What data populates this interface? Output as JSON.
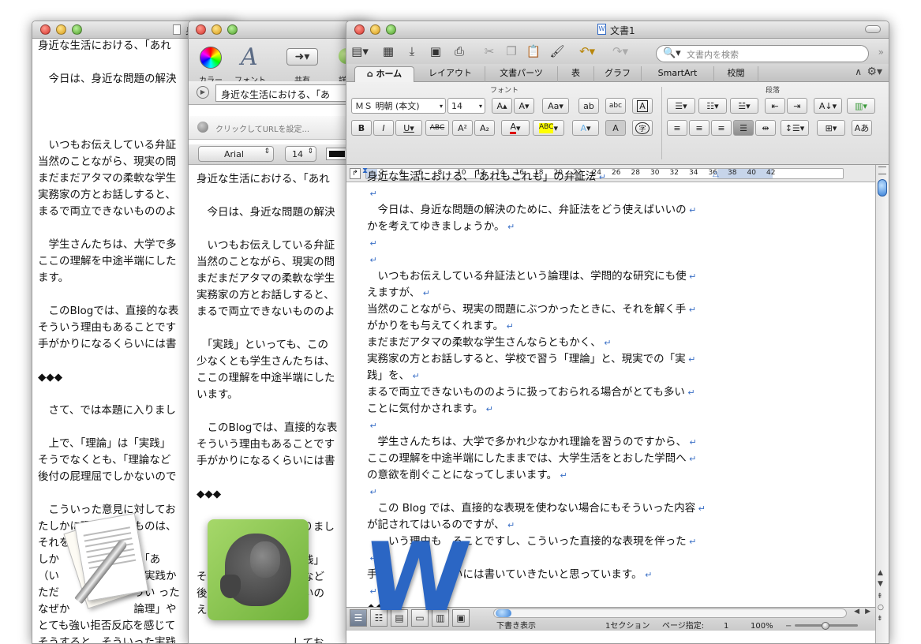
{
  "win1": {
    "title_fragment": "身",
    "lines": [
      "身近な生活における、「あれ",
      "",
      "　今日は、身近な問題の解決",
      "",
      "",
      "",
      "　いつもお伝えしている弁証",
      "当然のことながら、現実の問",
      "まだまだアタマの柔軟な学生",
      "実務家の方とお話しすると、",
      "まるで両立できないもののよ",
      "",
      "　学生さんたちは、大学で多",
      "ここの理解を中途半端にした",
      "ます。",
      "",
      "　このBlogでは、直接的な表",
      "そういう理由もあることです",
      "手がかりになるくらいには書",
      "",
      "◆◆◆",
      "",
      "　さて、では本題に入りまし",
      "",
      "　上で、「理論」は「実践」",
      "そうでなくとも、「理論など",
      "後付の屁理屈でしかないので",
      "",
      "　こういった意見に対してお",
      "たしかに理論というものは、",
      "それをたうえで理",
      "しか　　　　　　　　「あ",
      "（い　　　　　　　　実践か",
      "ただ　　　　　　　うい った",
      "なぜか　　　　　　論理」や",
      "とても強い拒否反応を感じて",
      "そうすると、そういった実践"
    ]
  },
  "win2": {
    "toolbar": {
      "color_label": "カラー",
      "font_label": "フォント",
      "share_label": "共有",
      "detail_label": "詳細"
    },
    "title_field": "身近な生活における、「あ",
    "url_placeholder": "クリックしてURLを設定...",
    "font_name": "Arial",
    "font_size": "14",
    "lines": [
      "身近な生活における、「あれ",
      "",
      "　今日は、身近な問題の解決",
      "",
      "　いつもお伝えしている弁証",
      "当然のことながら、現実の問",
      "まだまだアタマの柔軟な学生",
      "実務家の方とお話しすると、",
      "まるで両立できないもののよ",
      "",
      "　「実践」といっても、この",
      "少なくとも学生さんたちは、",
      "ここの理解を中途半端にした",
      "います。",
      "",
      "　このBlogでは、直接的な表",
      "そういう理由もあることです",
      "手がかりになるくらいには書",
      "",
      "◆◆◆",
      "",
      "　さて、では本題に入りまし",
      "",
      "　　　　　　　　　実践」",
      "そ　　　　　　　　論など",
      "後　　　　　　　　ないの",
      "え",
      "",
      "　　　　　　　　　してお",
      "たしかに理論というものは、"
    ]
  },
  "word": {
    "title": "文書1",
    "search_placeholder": "文書内を検索",
    "tabs": [
      "ホーム",
      "レイアウト",
      "文書パーツ",
      "表",
      "グラフ",
      "SmartArt",
      "校閲"
    ],
    "group_font": "フォント",
    "group_paragraph": "段落",
    "font_name": "ＭＳ 明朝 (本文)",
    "font_size": "14",
    "ruler_numbers": [
      "2",
      "4",
      "6",
      "8",
      "10",
      "12",
      "14",
      "16",
      "18",
      "20",
      "22",
      "24",
      "26",
      "28",
      "30",
      "32",
      "34",
      "36",
      "38",
      "40",
      "42"
    ],
    "lines": [
      "身近な生活における、「あれもこれも」の弁証法",
      "",
      "　今日は、身近な問題の解決のために、弁証法をどう使えばいいの",
      "かを考えてゆきましょうか。",
      "",
      "",
      "　いつもお伝えしている弁証法という論理は、学問的な研究にも使",
      "えますが、",
      "当然のことながら、現実の問題にぶつかったときに、それを解く手",
      "がかりをも与えてくれます。",
      "まだまだアタマの柔軟な学生さんならともかく、",
      "実務家の方とお話しすると、学校で習う「理論」と、現実での「実",
      "践」を、",
      "まるで両立できないもののように扱っておられる場合がとても多い",
      "ことに気付かされます。",
      "",
      "　学生さんたちは、大学で多かれ少なかれ理論を習うのですから、",
      "ここの理解を中途半端にしたままでは、大学生活をとおした学問へ",
      "の意欲を削ぐことになってしまいます。",
      "",
      "　この Blog では、直接的な表現を使わない場合にもそういった内容",
      "が記されてはいるのですが、",
      "　　いう理由も　ることですし、こういった直接的な表現を伴った",
      "",
      "手　　　　　　らいには書いていきたいと思っています。",
      "",
      "◆◆"
    ],
    "status": {
      "view": "下書き表示",
      "section": "1セクション",
      "page_label": "ページ指定:",
      "page": "1",
      "zoom": "100%"
    }
  },
  "colors": {
    "word_blue": "#2b66c4",
    "evernote_green": "#7fc241",
    "pilcrow": "#3a6fc6"
  }
}
